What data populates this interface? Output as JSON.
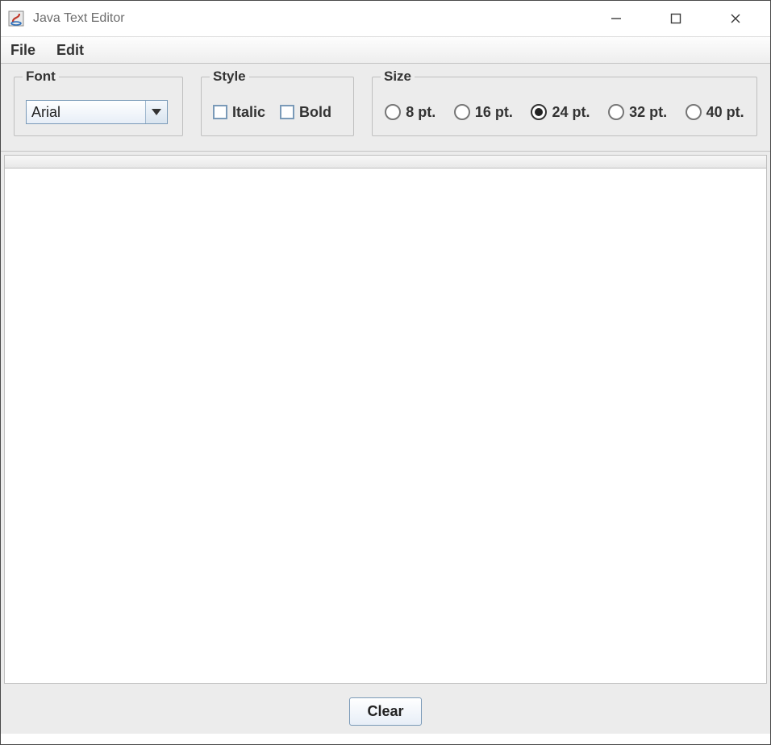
{
  "window": {
    "title": "Java Text Editor"
  },
  "menu": {
    "file": "File",
    "edit": "Edit"
  },
  "groups": {
    "font": {
      "legend": "Font",
      "selected": "Arial"
    },
    "style": {
      "legend": "Style",
      "italic": {
        "label": "Italic",
        "checked": false
      },
      "bold": {
        "label": "Bold",
        "checked": false
      }
    },
    "size": {
      "legend": "Size",
      "options": [
        {
          "label": "8 pt.",
          "selected": false
        },
        {
          "label": "16 pt.",
          "selected": false
        },
        {
          "label": "24 pt.",
          "selected": true
        },
        {
          "label": "32 pt.",
          "selected": false
        },
        {
          "label": "40 pt.",
          "selected": false
        }
      ]
    }
  },
  "editor": {
    "value": ""
  },
  "buttons": {
    "clear": "Clear"
  }
}
